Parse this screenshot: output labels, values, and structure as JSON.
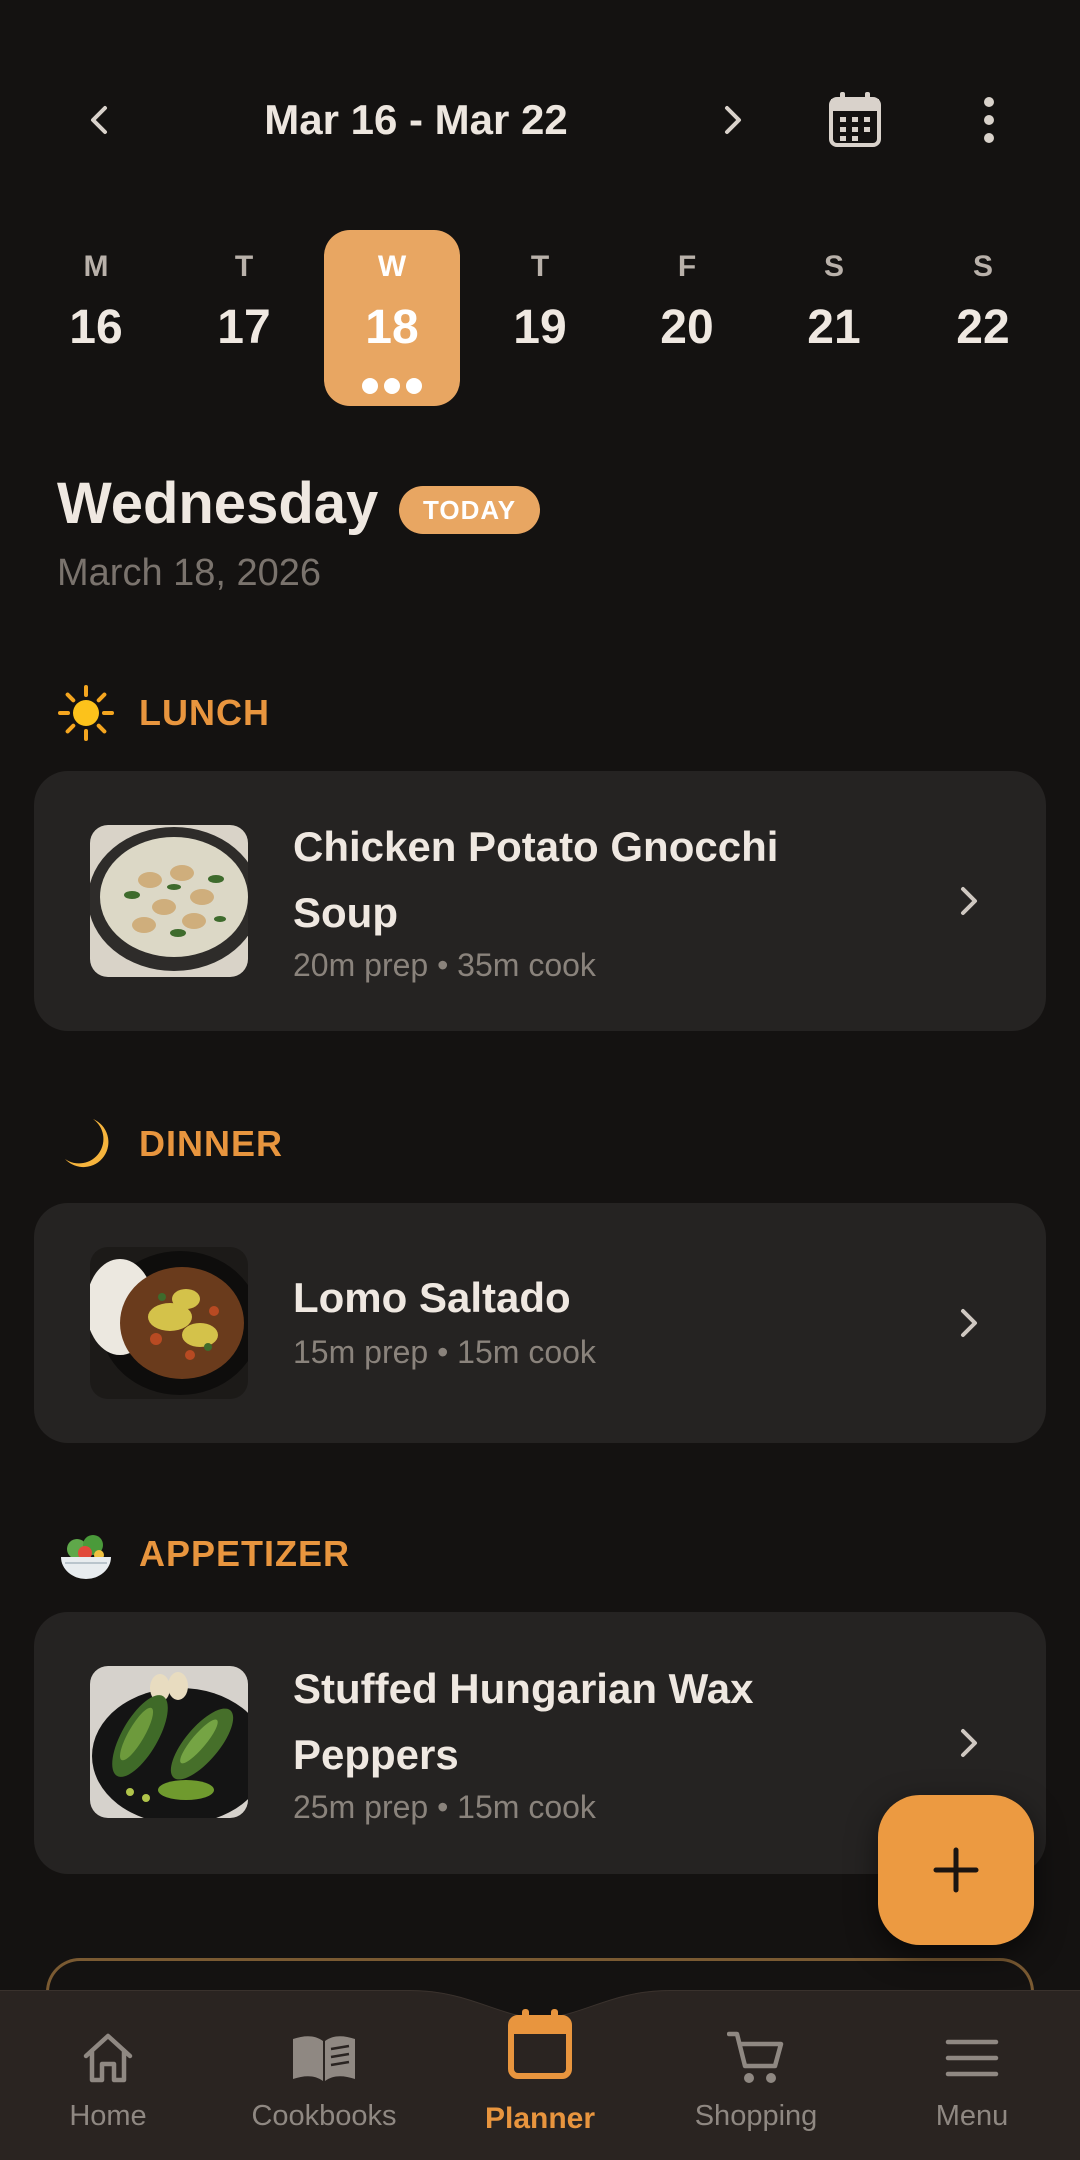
{
  "header": {
    "range_label": "Mar 16 - Mar 22",
    "prev_icon": "chevron-left-icon",
    "next_icon": "chevron-right-icon",
    "calendar_icon": "calendar-icon",
    "more_icon": "more-vertical-icon"
  },
  "week": {
    "days": [
      {
        "letter": "M",
        "number": "16",
        "selected": false
      },
      {
        "letter": "T",
        "number": "17",
        "selected": false
      },
      {
        "letter": "W",
        "number": "18",
        "selected": true
      },
      {
        "letter": "T",
        "number": "19",
        "selected": false
      },
      {
        "letter": "F",
        "number": "20",
        "selected": false
      },
      {
        "letter": "S",
        "number": "21",
        "selected": false
      },
      {
        "letter": "S",
        "number": "22",
        "selected": false
      }
    ],
    "selected_meal_dots": 3
  },
  "day": {
    "weekday": "Wednesday",
    "badge": "TODAY",
    "date": "March 18, 2026"
  },
  "meals": [
    {
      "section": "LUNCH",
      "section_icon": "sun-icon",
      "recipe": "Chicken Potato Gnocchi Soup",
      "meta": "20m prep • 35m cook"
    },
    {
      "section": "DINNER",
      "section_icon": "crescent-moon-icon",
      "recipe": "Lomo Saltado",
      "meta": "15m prep • 15m cook"
    },
    {
      "section": "APPETIZER",
      "section_icon": "salad-bowl-icon",
      "recipe": "Stuffed Hungarian Wax Peppers",
      "meta": "25m prep • 15m cook"
    }
  ],
  "fab": {
    "icon": "plus-icon"
  },
  "nav": {
    "items": [
      {
        "label": "Home",
        "icon": "home-icon",
        "active": false
      },
      {
        "label": "Cookbooks",
        "icon": "book-icon",
        "active": false
      },
      {
        "label": "Planner",
        "icon": "calendar-icon",
        "active": true
      },
      {
        "label": "Shopping",
        "icon": "cart-icon",
        "active": false
      },
      {
        "label": "Menu",
        "icon": "hamburger-menu-icon",
        "active": false
      }
    ]
  },
  "colors": {
    "background": "#141211",
    "card": "#252322",
    "accent": "#e8a662",
    "accent_text": "#e8953e",
    "fab": "#ec9a41"
  }
}
